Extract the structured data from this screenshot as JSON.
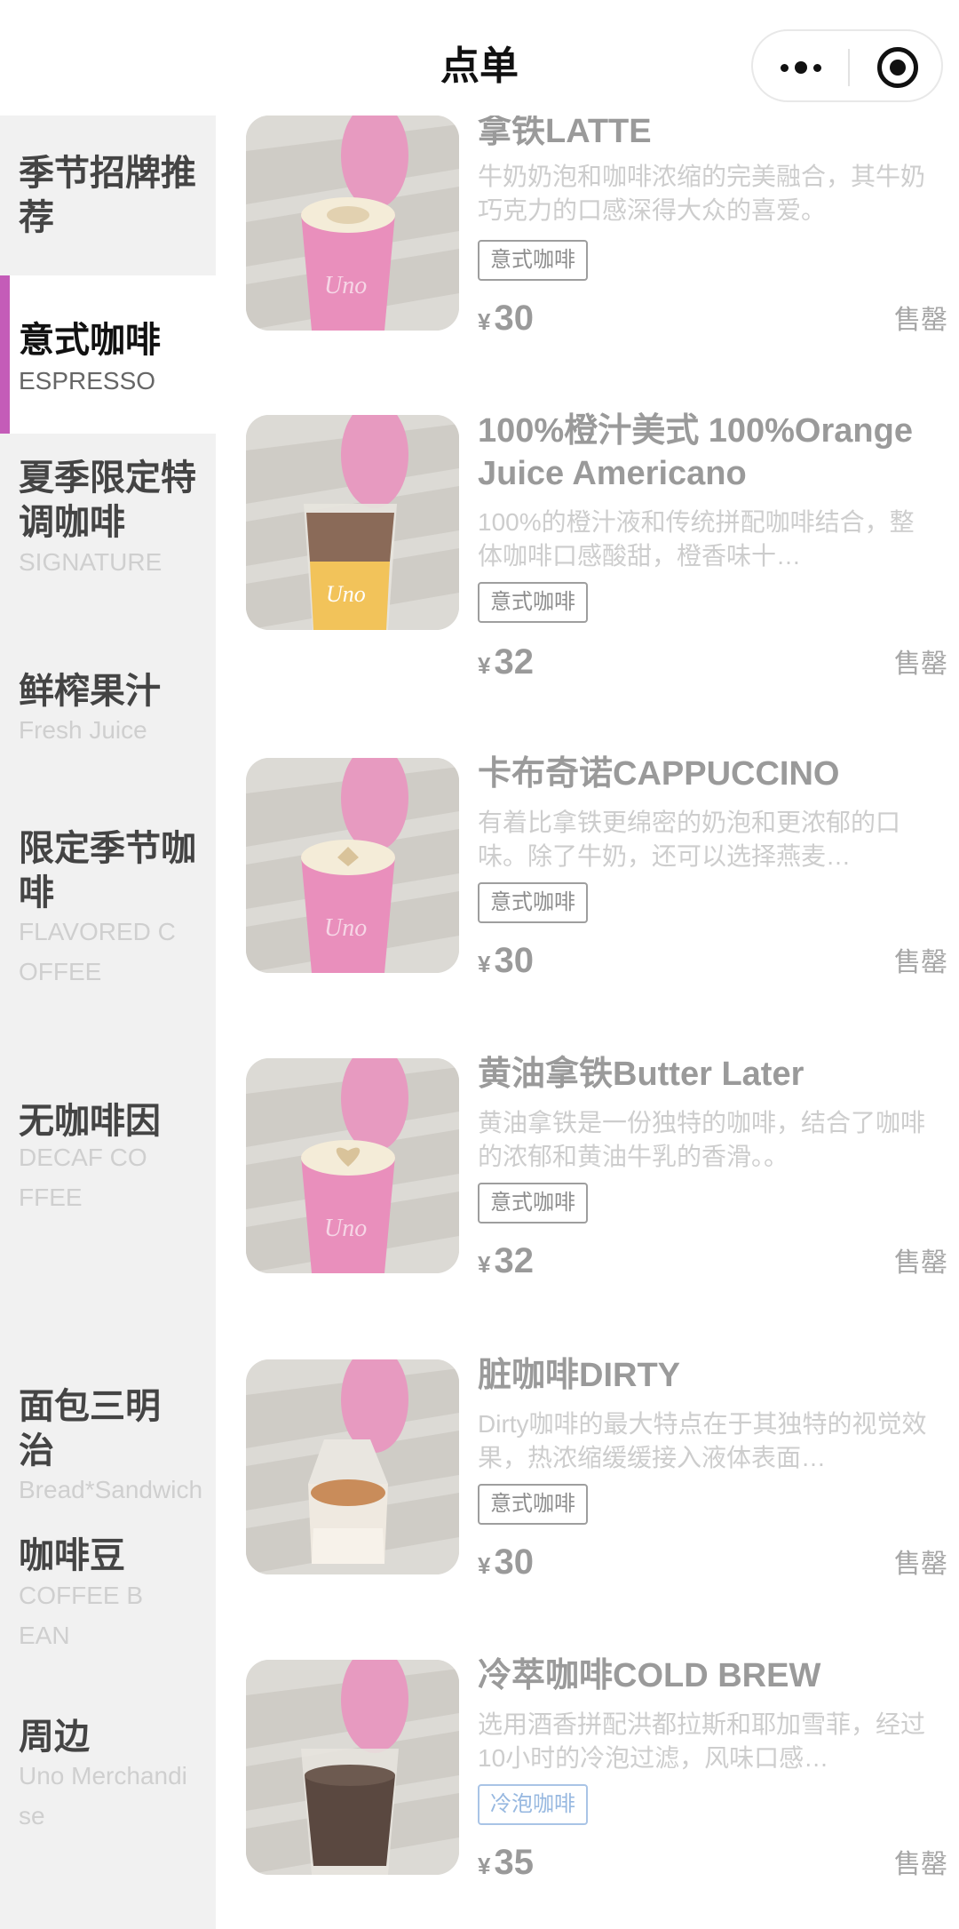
{
  "header": {
    "title": "点单"
  },
  "sidebar": {
    "categories": [
      {
        "zh": "季节招牌推荐",
        "en": ""
      },
      {
        "zh": "意式咖啡",
        "en": "ESPRESSO"
      },
      {
        "zh": "夏季限定特调咖啡",
        "en": "SIGNATURE"
      },
      {
        "zh": "鲜榨果汁",
        "en": "Fresh Juice"
      },
      {
        "zh": "限定季节咖啡",
        "en": "FLAVORED COFFEE"
      },
      {
        "zh": "无咖啡因",
        "en": "DECAF COFFEE"
      },
      {
        "zh": "面包三明治",
        "en": "Bread*Sandwich"
      },
      {
        "zh": "咖啡豆",
        "en": "COFFEE BEAN"
      },
      {
        "zh": "周边",
        "en": "Uno Merchandise"
      }
    ],
    "active_index": 1
  },
  "products": [
    {
      "name": "拿铁LATTE",
      "desc": "牛奶奶泡和咖啡浓缩的完美融合，其牛奶巧克力的口感深得大众的喜爱。",
      "tag": "意式咖啡",
      "currency": "¥",
      "price": "30",
      "status": "售罄",
      "icon": "latte-photo"
    },
    {
      "name": "100%橙汁美式 100%Orange Juice Americano",
      "desc": "100%的橙汁液和传统拼配咖啡结合，整体咖啡口感酸甜，橙香味十…",
      "tag": "意式咖啡",
      "currency": "¥",
      "price": "32",
      "status": "售罄",
      "icon": "orange-americano-photo"
    },
    {
      "name": "卡布奇诺CAPPUCCINO",
      "desc": "有着比拿铁更绵密的奶泡和更浓郁的口味。除了牛奶，还可以选择燕麦…",
      "tag": "意式咖啡",
      "currency": "¥",
      "price": "30",
      "status": "售罄",
      "icon": "cappuccino-photo"
    },
    {
      "name": "黄油拿铁Butter Later",
      "desc": "黄油拿铁是一份独特的咖啡，结合了咖啡的浓郁和黄油牛乳的香滑。。",
      "tag": "意式咖啡",
      "currency": "¥",
      "price": "32",
      "status": "售罄",
      "icon": "butter-latte-photo"
    },
    {
      "name": "脏咖啡DIRTY",
      "desc": "Dirty咖啡的最大特点在于其独特的视觉效果，热浓缩缓缓接入液体表面…",
      "tag": "意式咖啡",
      "currency": "¥",
      "price": "30",
      "status": "售罄",
      "icon": "dirty-coffee-photo"
    },
    {
      "name": "冷萃咖啡COLD BREW",
      "desc": "选用酒香拼配洪都拉斯和耶加雪菲，经过10小时的冷泡过滤，风味口感…",
      "tag": "冷泡咖啡",
      "currency": "¥",
      "price": "35",
      "status": "售罄",
      "icon": "cold-brew-photo"
    }
  ],
  "colors": {
    "accent_bar": "#c45cb8",
    "cup_pink": "#e0609a",
    "cold_tag": "#97b8e0"
  }
}
